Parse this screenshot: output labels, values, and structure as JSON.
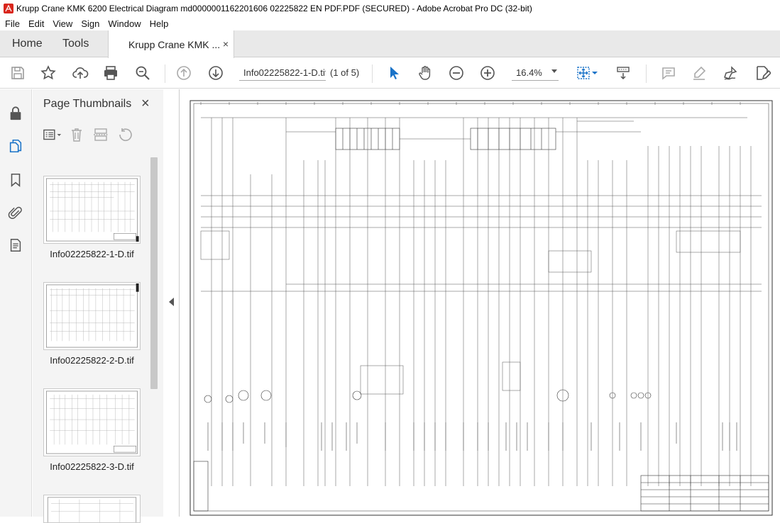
{
  "window": {
    "title": "Krupp Crane KMK 6200 Electrical Diagram md0000001162201606 02225822 EN PDF.PDF (SECURED) - Adobe Acrobat Pro DC (32-bit)"
  },
  "menu": [
    "File",
    "Edit",
    "View",
    "Sign",
    "Window",
    "Help"
  ],
  "tabs": {
    "home": "Home",
    "tools": "Tools",
    "doc": "Krupp Crane KMK ...",
    "close": "×"
  },
  "toolbar": {
    "page_field": "Info02225822-1-D.tif",
    "page_count": "(1 of 5)",
    "zoom": "16.4%"
  },
  "panel": {
    "title": "Page Thumbnails",
    "close": "×",
    "thumbnails": [
      {
        "label": "Info02225822-1-D.tif"
      },
      {
        "label": "Info02225822-2-D.tif"
      },
      {
        "label": "Info02225822-3-D.tif"
      }
    ]
  },
  "icons": {
    "app": "acrobat-icon",
    "save": "save-icon",
    "bookmark": "star-icon",
    "upload": "upload-icon",
    "print": "print-icon",
    "zoom_out_search": "magnifier-icon",
    "prev": "arrow-up-icon",
    "next": "arrow-down-icon",
    "select": "cursor-icon",
    "hand": "hand-icon",
    "zoom_out": "minus-circle-icon",
    "zoom_in": "plus-circle-icon",
    "fit": "fit-page-icon",
    "scroll": "scroll-mode-icon",
    "comment": "comment-icon",
    "highlight": "highlight-icon",
    "sign": "sign-icon",
    "edit": "edit-pdf-icon"
  }
}
